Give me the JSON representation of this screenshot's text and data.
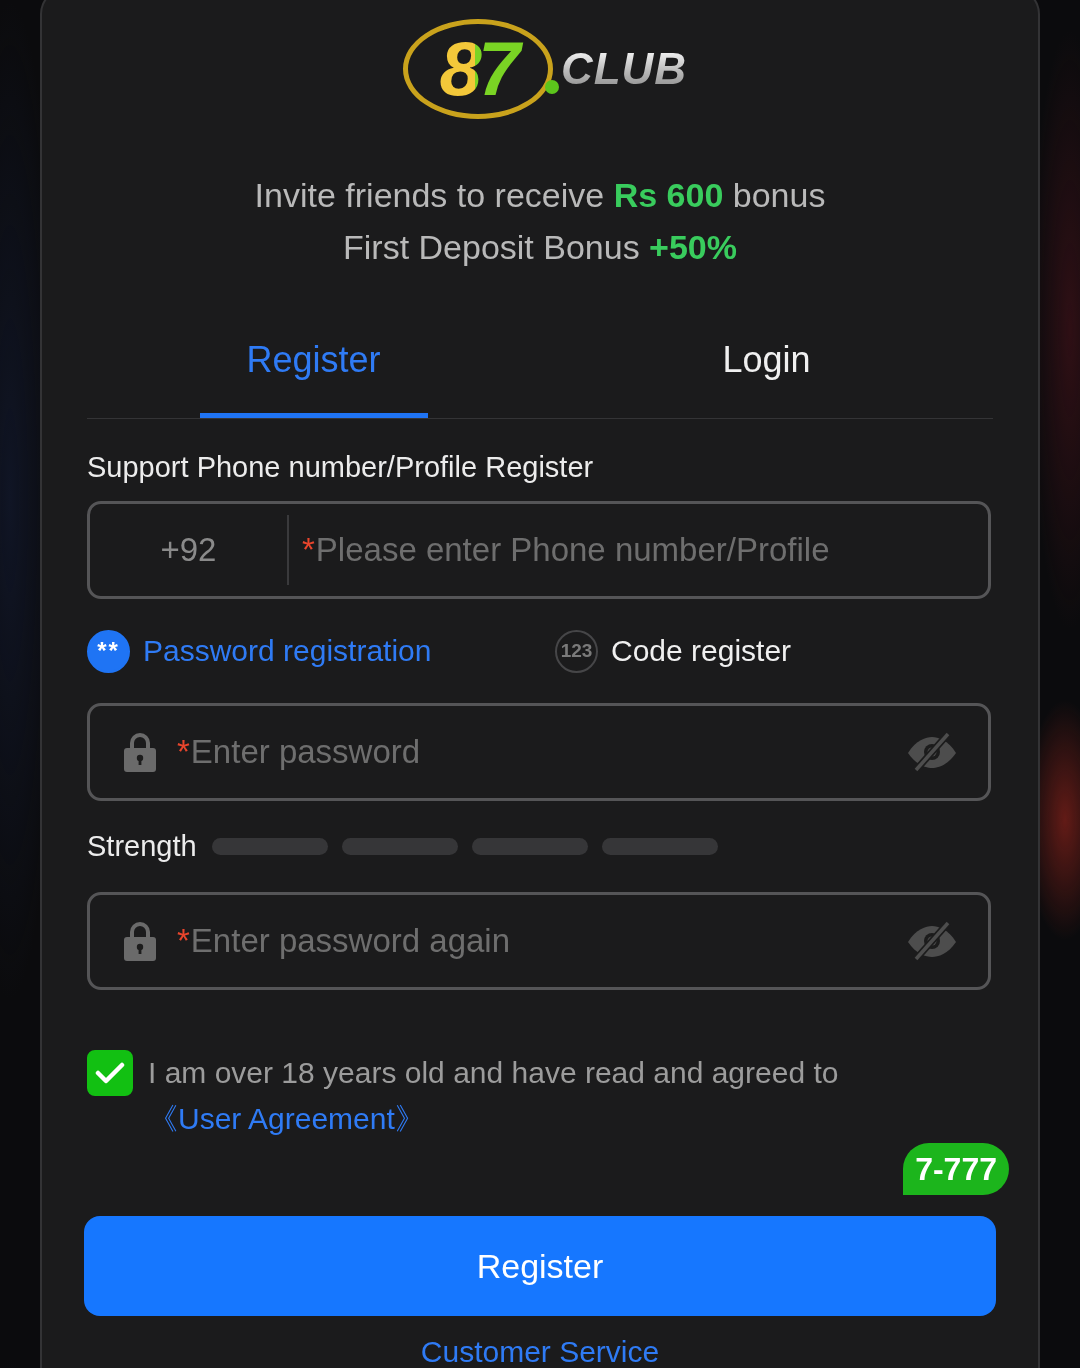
{
  "logo": {
    "mark": "87",
    "wordmark": "CLUB"
  },
  "promo": [
    "Invite friends to receive **Rs 600** bonus",
    "First Deposit Bonus **+50%**"
  ],
  "tabs": [
    {
      "label": "Register",
      "selected": true
    },
    {
      "label": "Login",
      "selected": false
    }
  ],
  "phone": {
    "label": "Support Phone number/Profile Register",
    "country_code": "+92",
    "required_mark": "*",
    "placeholder": "Please enter Phone number/Profile"
  },
  "modes": [
    {
      "icon_text": "**",
      "label": "Password registration",
      "selected": true
    },
    {
      "icon_text": "123",
      "label": "Code register",
      "selected": false
    }
  ],
  "password": {
    "required_mark": "*",
    "placeholder": "Enter password"
  },
  "strength": {
    "label": "Strength",
    "segments": [
      {
        "on": false
      },
      {
        "on": false
      },
      {
        "on": false
      },
      {
        "on": false
      }
    ]
  },
  "confirm_password": {
    "required_mark": "*",
    "placeholder": "Enter password again"
  },
  "agreement": {
    "checked": true,
    "text": "I am over 18 years old and have read and agreed to",
    "link": "《User Agreement》"
  },
  "promo_bubble": "7-777",
  "register_button": "Register",
  "customer_service": "Customer Service"
}
